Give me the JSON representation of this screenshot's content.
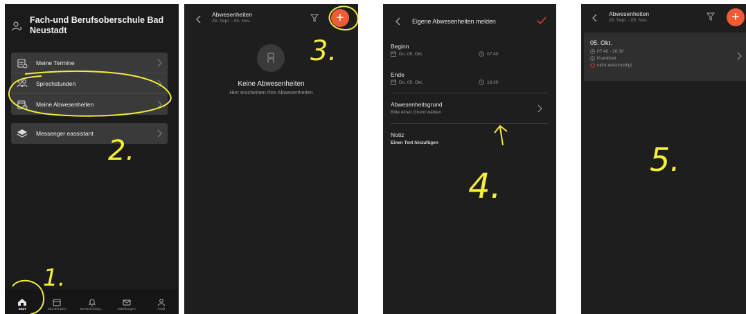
{
  "screen1": {
    "school_line1": "Fach-und Berufsoberschule Bad",
    "school_line2": "Neustadt",
    "menu_group_1": [
      {
        "label": "Meine Termine",
        "icon": "calendar-list-icon"
      },
      {
        "label": "Sprechstunden",
        "icon": "people-icon"
      },
      {
        "label": "Meine Abwesenheiten",
        "icon": "calendar-clock-icon"
      }
    ],
    "menu_group_2": [
      {
        "label": "Messenger eassistant",
        "icon": "layers-icon"
      }
    ],
    "tabs": [
      {
        "label": "Start",
        "icon": "home-icon",
        "active": true
      },
      {
        "label": "Stundenplan",
        "icon": "calendar-icon",
        "active": false
      },
      {
        "label": "Benachrichtig...",
        "icon": "bell-icon",
        "active": false
      },
      {
        "label": "Mitteilungen",
        "icon": "mail-icon",
        "active": false
      },
      {
        "label": "Profil",
        "icon": "person-icon",
        "active": false
      }
    ]
  },
  "screen2": {
    "title": "Abwesenheiten",
    "range": "28. Sept. - 05. Nov.",
    "empty_title": "Keine Abwesenheiten",
    "empty_sub": "Hier erscheinen Ihre Abwesenheiten"
  },
  "screen3": {
    "title": "Eigene Abwesenheiten melden",
    "begin_label": "Beginn",
    "begin_date": "Do. 05. Okt.",
    "begin_time": "07:40",
    "end_label": "Ende",
    "end_date": "Do. 05. Okt.",
    "end_time": "16:30",
    "reason_label": "Abwesenheitsgrund",
    "reason_placeholder": "Bitte einen Grund wählen",
    "note_label": "Notiz",
    "note_placeholder": "Einen Text hinzufügen"
  },
  "screen4": {
    "title": "Abwesenheiten",
    "range": "28. Sept. - 05. Nov.",
    "entry_date": "05. Okt.",
    "entry_time": "07:40 - 16:30",
    "entry_reason": "Krankheit",
    "entry_status": "nicht entschuldigt"
  },
  "annotations": {
    "n1": "1.",
    "n2": "2.",
    "n3": "3.",
    "n4": "4.",
    "n5": "5."
  },
  "colors": {
    "accent": "#f05a35",
    "confirm": "#e0383c",
    "status_red": "#e0383c",
    "handwriting": "#f3ee3c",
    "screen_bg": "#1e1e1e",
    "card_bg": "#3a3a3a"
  }
}
